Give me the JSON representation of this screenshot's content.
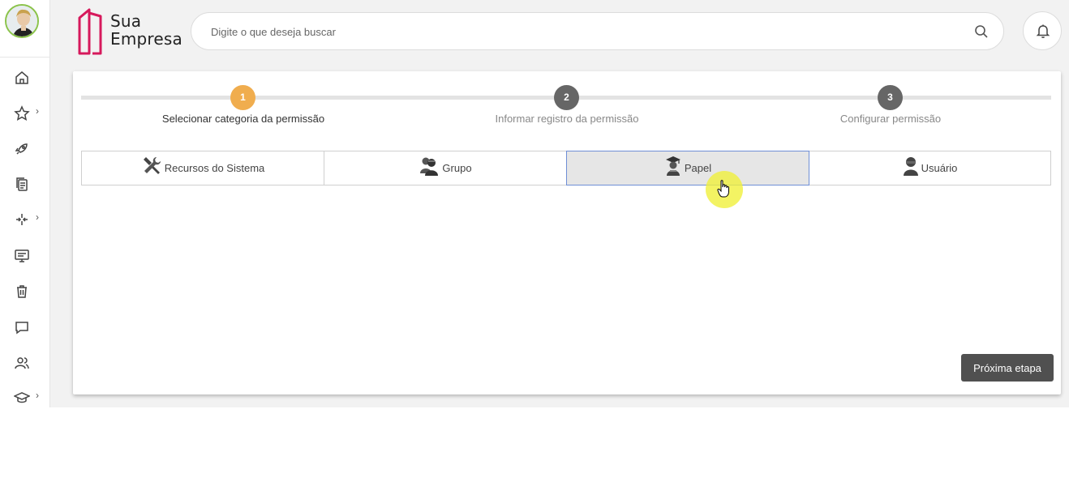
{
  "brand": {
    "name_line1": "Sua",
    "name_line2": "Empresa",
    "logo_color": "#d6195c"
  },
  "search": {
    "placeholder": "Digite o que deseja buscar"
  },
  "sidebar": {
    "items": [
      {
        "icon": "home-icon"
      },
      {
        "icon": "star-icon",
        "has_submenu": true
      },
      {
        "icon": "rocket-icon"
      },
      {
        "icon": "documents-icon"
      },
      {
        "icon": "arrows-icon",
        "has_submenu": true
      },
      {
        "icon": "monitor-icon"
      },
      {
        "icon": "trash-icon"
      },
      {
        "icon": "chat-icon"
      },
      {
        "icon": "users-icon"
      },
      {
        "icon": "graduation-cap-icon",
        "has_submenu": true
      }
    ],
    "chevron": "›"
  },
  "stepper": {
    "steps": [
      {
        "number": "1",
        "label": "Selecionar categoria da permissão",
        "active": true
      },
      {
        "number": "2",
        "label": "Informar registro da permissão",
        "active": false
      },
      {
        "number": "3",
        "label": "Configurar permissão",
        "active": false
      }
    ],
    "active_color": "#f0ad4e",
    "inactive_color": "#666666"
  },
  "categories": [
    {
      "label": "Recursos do Sistema",
      "icon": "tools-icon",
      "selected": false
    },
    {
      "label": "Grupo",
      "icon": "group-icon",
      "selected": false
    },
    {
      "label": "Papel",
      "icon": "graduate-user-icon",
      "selected": true
    },
    {
      "label": "Usuário",
      "icon": "user-icon",
      "selected": false
    }
  ],
  "actions": {
    "next_label": "Próxima etapa"
  }
}
